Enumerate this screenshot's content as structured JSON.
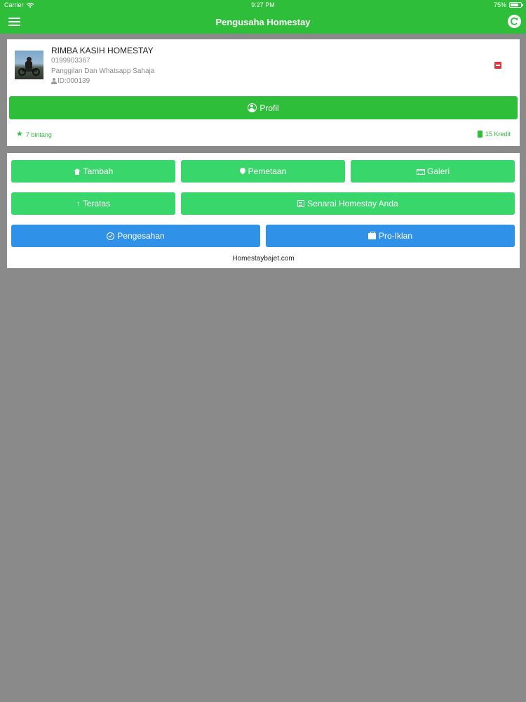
{
  "status_bar": {
    "carrier": "Carrier",
    "time": "9:27 PM",
    "battery": "75%",
    "battery_level": 0.75
  },
  "navbar": {
    "title": "Pengusaha Homestay",
    "menu_icon": "hamburger-menu-icon",
    "refresh_icon": "refresh-icon"
  },
  "profile": {
    "name": "RIMBA KASIH HOMESTAY",
    "phone": "0199903367",
    "note": "Panggilan Dan Whatsapp Sahaja",
    "id": "ID:000139",
    "profile_button": "Profil",
    "stars": "7 bintang",
    "credit": "15 Kredit",
    "logout_icon": "logout-icon"
  },
  "actions": {
    "tambah": "Tambah",
    "pemetaan": "Pemetaan",
    "galeri": "Galeri",
    "teratas": "Teratas",
    "teratas_icon": "↑",
    "senarai": "Senarai Homestay Anda",
    "pengesahan": "Pengesahan",
    "pro_iklan": "Pro-Iklan",
    "website": "Homestaybajet.com"
  },
  "colors": {
    "primary_green": "#2fbe3a",
    "button_green": "#38d66b",
    "button_blue": "#2f92e8",
    "logout_red": "#e0383e",
    "background": "#8a8a8a"
  }
}
